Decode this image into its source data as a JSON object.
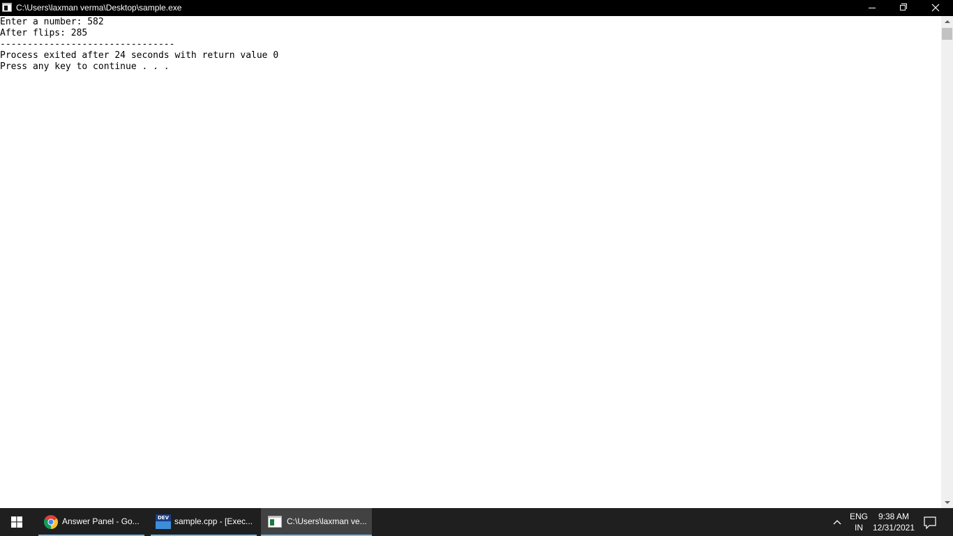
{
  "window": {
    "title": "C:\\Users\\laxman verma\\Desktop\\sample.exe"
  },
  "console": {
    "lines": [
      "Enter a number: 582",
      "After flips: 285",
      "--------------------------------",
      "Process exited after 24 seconds with return value 0",
      "Press any key to continue . . ."
    ]
  },
  "taskbar": {
    "items": [
      {
        "label": "Answer Panel - Go...",
        "icon": "chrome-icon",
        "active": false
      },
      {
        "label": "sample.cpp - [Exec...",
        "icon": "devcpp-icon",
        "icon_text": "DEV",
        "active": false
      },
      {
        "label": "C:\\Users\\laxman ve...",
        "icon": "console-icon",
        "active": true
      }
    ],
    "tray": {
      "lang_primary": "ENG",
      "lang_secondary": "IN",
      "time": "9:38 AM",
      "date": "12/31/2021"
    }
  },
  "colors": {
    "titlebar_bg": "#000000",
    "console_bg": "#ffffff",
    "console_text": "#000000",
    "taskbar_bg": "#1f1f1f",
    "taskbar_active_bg": "#424242",
    "taskbar_underline": "#76b9ed"
  }
}
